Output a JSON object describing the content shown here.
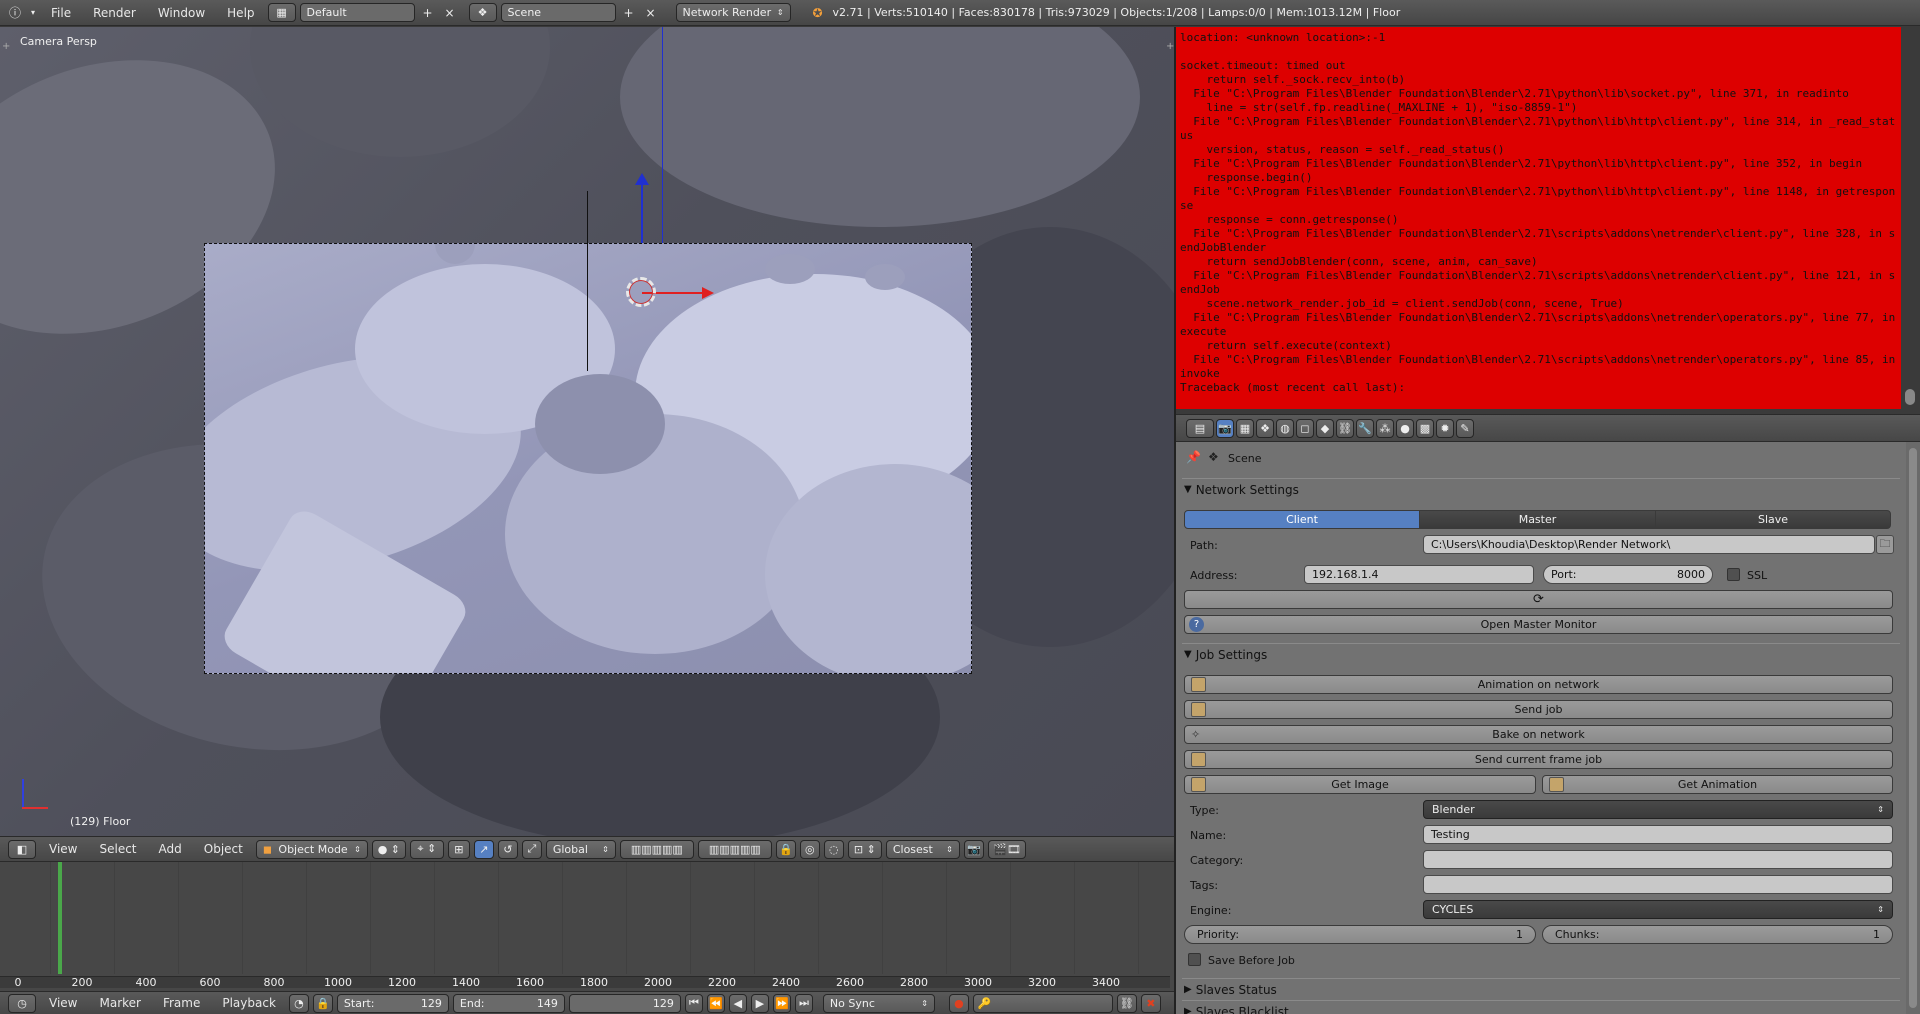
{
  "topbar": {
    "menus": [
      "File",
      "Render",
      "Window",
      "Help"
    ],
    "screen_layout": "Default",
    "scene": "Scene",
    "render_engine": "Network Render",
    "stats": "v2.71 | Verts:510140 | Faces:830178 | Tris:973029 | Objects:1/208 | Lamps:0/0 | Mem:1013.12M | Floor"
  },
  "viewport": {
    "view_label": "Camera Persp",
    "frame_label": "(129) Floor",
    "header": {
      "menus": [
        "View",
        "Select",
        "Add",
        "Object"
      ],
      "mode": "Object Mode",
      "orientation": "Global",
      "snap": "Closest"
    }
  },
  "timeline": {
    "ruler": [
      "0",
      "200",
      "400",
      "600",
      "800",
      "1000",
      "1200",
      "1400",
      "1600",
      "1800",
      "2000",
      "2200",
      "2400",
      "2600",
      "2800",
      "3000",
      "3200",
      "3400"
    ],
    "current_frame_fraction": 0.03,
    "header": {
      "menus": [
        "View",
        "Marker",
        "Frame",
        "Playback"
      ],
      "start_label": "Start:",
      "start_value": "129",
      "end_label": "End:",
      "end_value": "149",
      "current": "129",
      "sync": "No Sync"
    }
  },
  "console": {
    "background": "#dd0000",
    "lines": [
      "location: <unknown location>:-1",
      "",
      "socket.timeout: timed out",
      "    return self._sock.recv_into(b)",
      "  File \"C:\\Program Files\\Blender Foundation\\Blender\\2.71\\python\\lib\\socket.py\", line 371, in readinto",
      "    line = str(self.fp.readline(_MAXLINE + 1), \"iso-8859-1\")",
      "  File \"C:\\Program Files\\Blender Foundation\\Blender\\2.71\\python\\lib\\http\\client.py\", line 314, in _read_status",
      "    version, status, reason = self._read_status()",
      "  File \"C:\\Program Files\\Blender Foundation\\Blender\\2.71\\python\\lib\\http\\client.py\", line 352, in begin",
      "    response.begin()",
      "  File \"C:\\Program Files\\Blender Foundation\\Blender\\2.71\\python\\lib\\http\\client.py\", line 1148, in getresponse",
      "    response = conn.getresponse()",
      "  File \"C:\\Program Files\\Blender Foundation\\Blender\\2.71\\scripts\\addons\\netrender\\client.py\", line 328, in sendJobBlender",
      "    return sendJobBlender(conn, scene, anim, can_save)",
      "  File \"C:\\Program Files\\Blender Foundation\\Blender\\2.71\\scripts\\addons\\netrender\\client.py\", line 121, in sendJob",
      "    scene.network_render.job_id = client.sendJob(conn, scene, True)",
      "  File \"C:\\Program Files\\Blender Foundation\\Blender\\2.71\\scripts\\addons\\netrender\\operators.py\", line 77, in execute",
      "    return self.execute(context)",
      "  File \"C:\\Program Files\\Blender Foundation\\Blender\\2.71\\scripts\\addons\\netrender\\operators.py\", line 85, in invoke",
      "Traceback (most recent call last):"
    ]
  },
  "properties": {
    "breadcrumb": "Scene",
    "network_settings": {
      "title": "Network Settings",
      "modes": [
        "Client",
        "Master",
        "Slave"
      ],
      "active_mode": "Client",
      "path_label": "Path:",
      "path_value": "C:\\Users\\Khoudia\\Desktop\\Render Network\\",
      "address_label": "Address:",
      "address_value": "192.168.1.4",
      "port_label": "Port:",
      "port_value": "8000",
      "ssl_label": "SSL",
      "monitor_button": "Open Master Monitor"
    },
    "job_settings": {
      "title": "Job Settings",
      "buttons": [
        "Animation on network",
        "Send job",
        "Bake on network",
        "Send current frame job"
      ],
      "get_image": "Get Image",
      "get_animation": "Get Animation",
      "type_label": "Type:",
      "type_value": "Blender",
      "name_label": "Name:",
      "name_value": "Testing",
      "category_label": "Category:",
      "category_value": "",
      "tags_label": "Tags:",
      "tags_value": "",
      "engine_label": "Engine:",
      "engine_value": "CYCLES",
      "priority_label": "Priority:",
      "priority_value": "1",
      "chunks_label": "Chunks:",
      "chunks_value": "1",
      "save_before_job": "Save Before Job"
    },
    "collapsed_panels": [
      "Slaves Status",
      "Slaves Blacklist"
    ]
  },
  "colors": {
    "accent_blue": "#5680c2",
    "console_red": "#dd0000",
    "frame_cursor": "#4aa84a"
  }
}
